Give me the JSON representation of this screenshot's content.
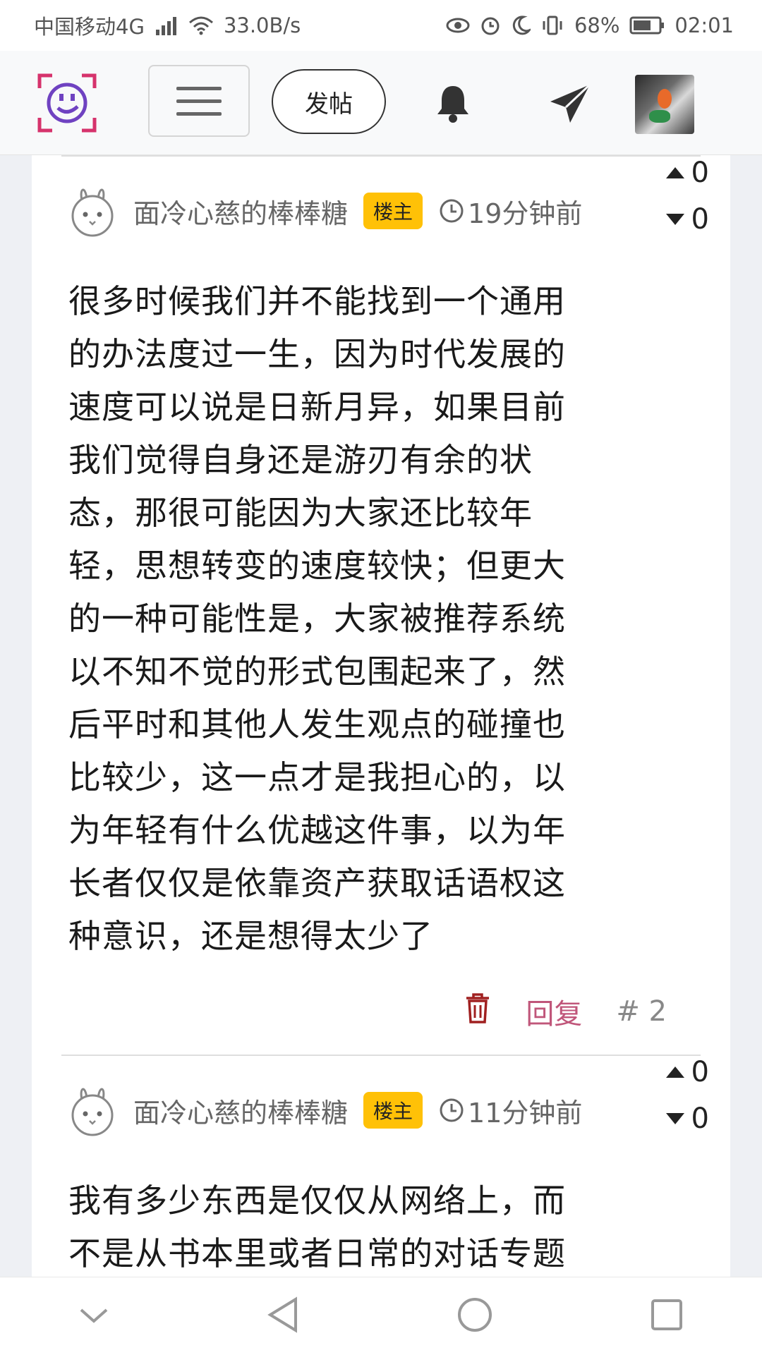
{
  "status_bar": {
    "carrier": "中国移动4G",
    "network_badge": "4G",
    "speed": "33.0B/s",
    "battery": "68%",
    "time": "02:01"
  },
  "navbar": {
    "post_button": "发帖",
    "icons": [
      "logo-icon",
      "menu-icon",
      "bell-icon",
      "send-icon",
      "user-avatar"
    ]
  },
  "posts": [
    {
      "author": "面冷心慈的棒棒糖",
      "badge": "楼主",
      "time": "19分钟前",
      "upvotes": "0",
      "downvotes": "0",
      "lines": [
        "很多时候我们并不能找到一个通用",
        "的办法度过一生，因为时代发展的",
        "速度可以说是日新月异，如果目前",
        "我们觉得自身还是游刃有余的状",
        "态，那很可能因为大家还比较年",
        "轻，思想转变的速度较快；但更大",
        "的一种可能性是，大家被推荐系统",
        "以不知不觉的形式包围起来了，然",
        "后平时和其他人发生观点的碰撞也",
        "比较少，这一点才是我担心的，以",
        "为年轻有什么优越这件事，以为年",
        "长者仅仅是依靠资产获取话语权这",
        "种意识，还是想得太少了"
      ],
      "reply_label": "回复",
      "floor": "# 2"
    },
    {
      "author": "面冷心慈的棒棒糖",
      "badge": "楼主",
      "time": "11分钟前",
      "upvotes": "0",
      "downvotes": "0",
      "lines": [
        "我有多少东西是仅仅从网络上，而",
        "不是从书本里或者日常的对话专题"
      ]
    }
  ],
  "colors": {
    "badge": "#ffc107",
    "reply": "#c0567a",
    "delete": "#a02020",
    "logo": "#d6336c"
  }
}
